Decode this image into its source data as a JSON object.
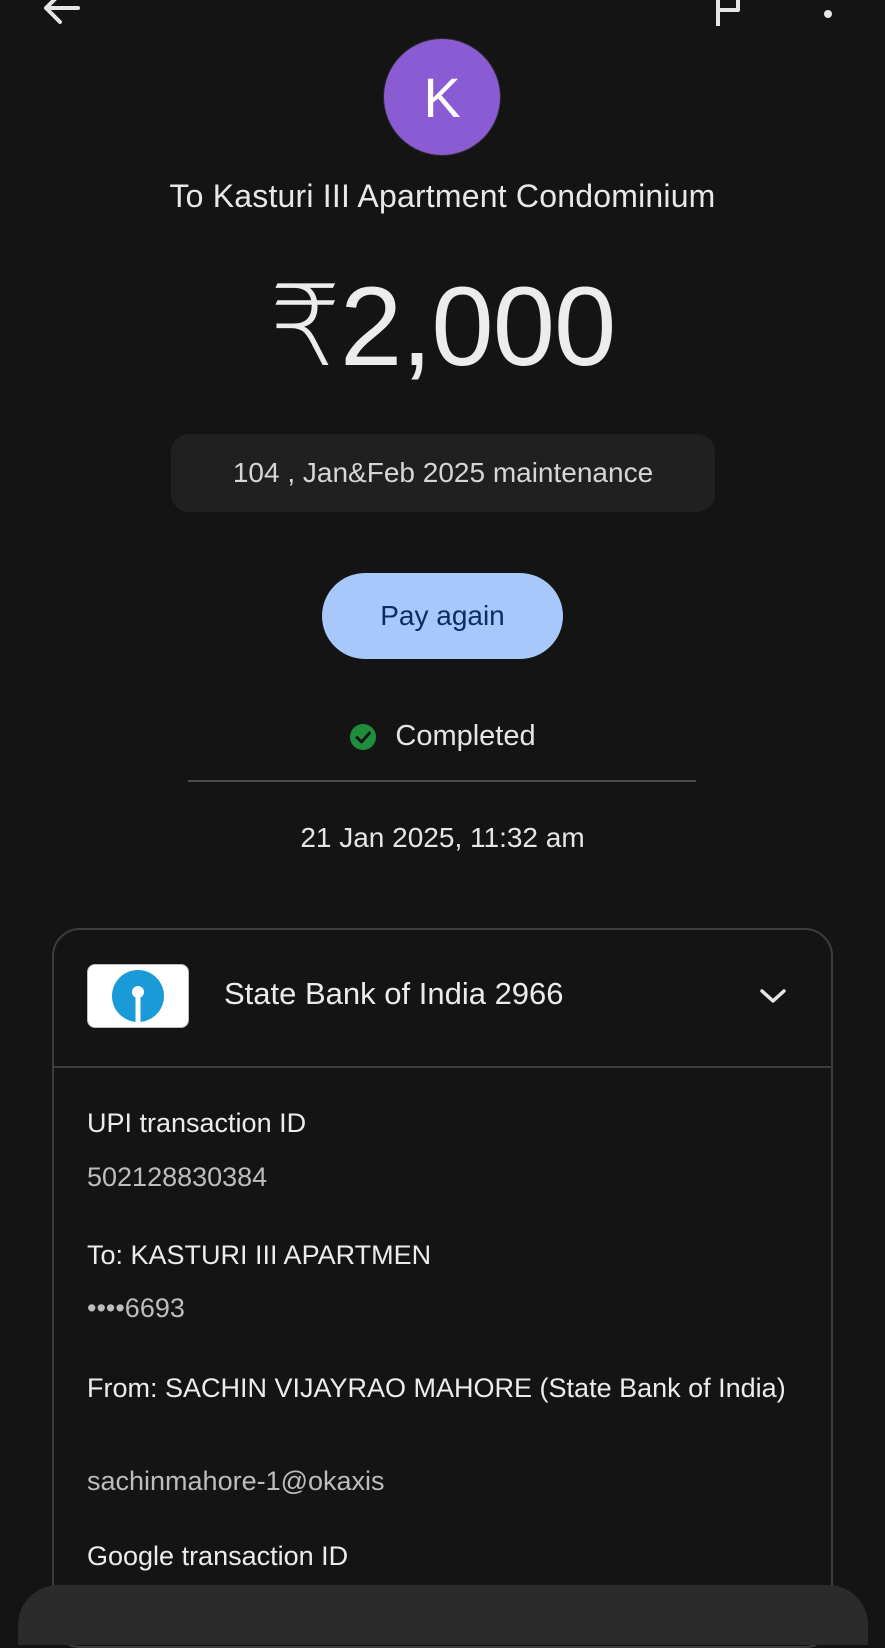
{
  "recipient": {
    "avatar_letter": "K",
    "title": "To Kasturi III Apartment Condominium"
  },
  "payment": {
    "amount": "₹2,000",
    "note": "104 , Jan&Feb 2025 maintenance",
    "pay_again_label": "Pay again",
    "status": "Completed",
    "datetime": "21 Jan 2025, 11:32 am"
  },
  "bank": {
    "name": "State Bank of India 2966"
  },
  "details": {
    "upi_label": "UPI transaction ID",
    "upi_value": "502128830384",
    "to_label": "To: KASTURI III APARTMEN",
    "to_value": "••••6693",
    "from_label": "From: SACHIN VIJAYRAO MAHORE (State Bank of India)",
    "from_value": "sachinmahore-1@okaxis",
    "google_label": "Google transaction ID"
  },
  "colors": {
    "background": "#141414",
    "avatar": "#8a5bd2",
    "pay_button": "#a8c7fa",
    "status_green": "#1e8e3e",
    "sbi_blue": "#1a9ad6"
  },
  "icons": {
    "back": "arrow-left-icon",
    "report": "flag-icon",
    "more": "more-vert-icon",
    "status": "check-circle-icon",
    "expand": "chevron-down-icon"
  }
}
